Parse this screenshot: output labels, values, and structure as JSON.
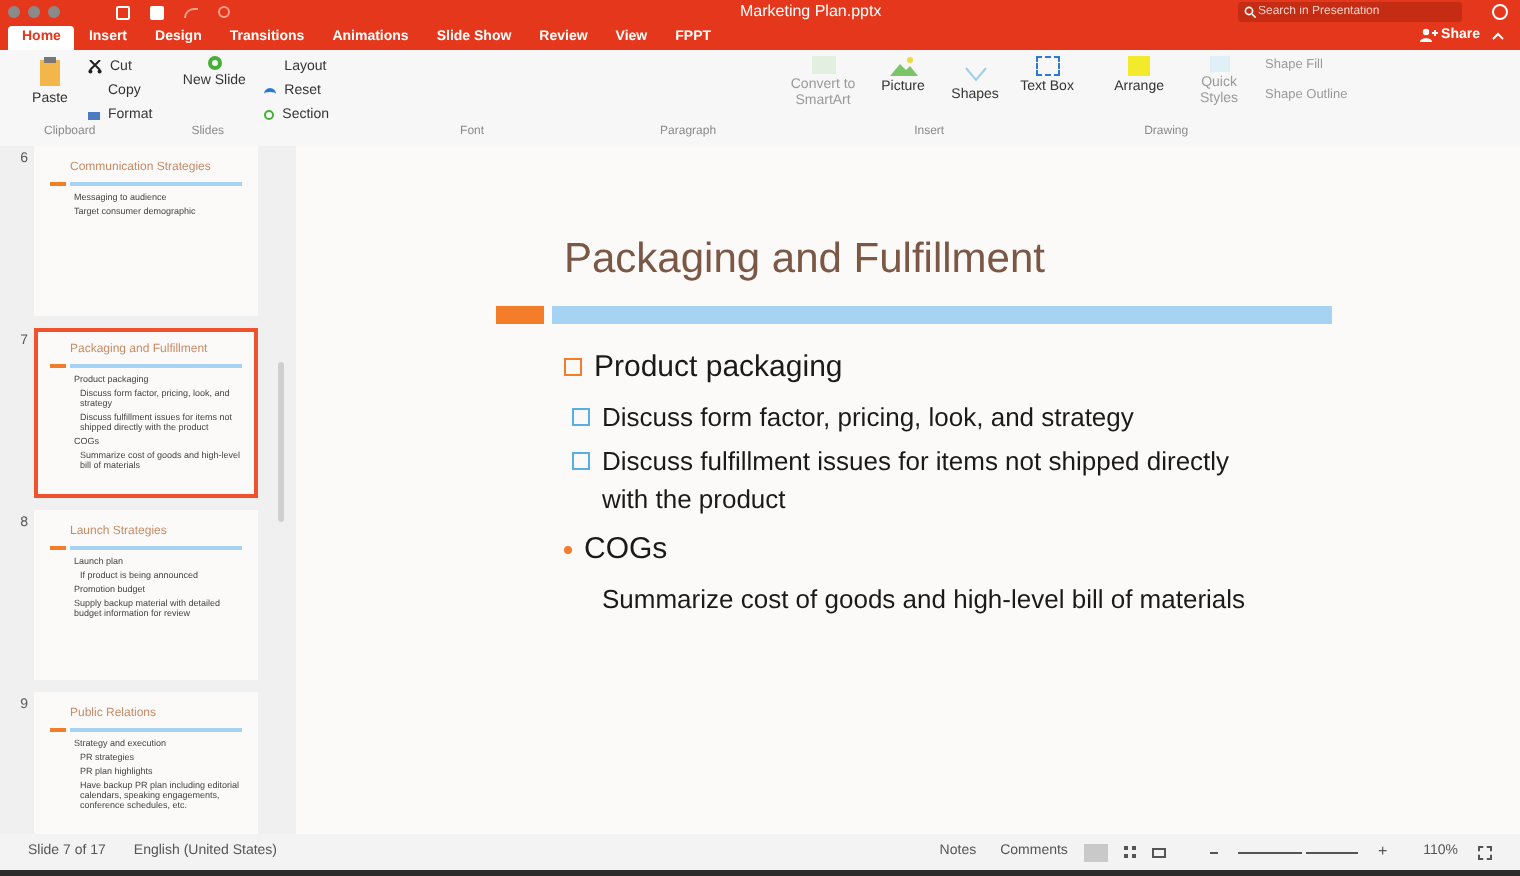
{
  "window": {
    "title": "Marketing Plan.pptx"
  },
  "search": {
    "placeholder": "Search in Presentation"
  },
  "tabs": [
    {
      "label": "Home",
      "selected": true
    },
    {
      "label": "Insert",
      "selected": false
    },
    {
      "label": "Design",
      "selected": false
    },
    {
      "label": "Transitions",
      "selected": false
    },
    {
      "label": "Animations",
      "selected": false
    },
    {
      "label": "Slide Show",
      "selected": false
    },
    {
      "label": "Review",
      "selected": false
    },
    {
      "label": "View",
      "selected": false
    },
    {
      "label": "FPPT",
      "selected": false
    }
  ],
  "share": "Share",
  "ribbon": {
    "paste": "Paste",
    "cut": "Cut",
    "copy": "Copy",
    "format": "Format",
    "new_slide": "New Slide",
    "layout": "Layout",
    "reset": "Reset",
    "section": "Section",
    "convert": {
      "label": "Convert to SmartArt",
      "disabled": true
    },
    "picture": "Picture",
    "shapes": "Shapes",
    "text_box": "Text Box",
    "arrange": "Arrange",
    "quick_styles": {
      "label": "Quick Styles",
      "disabled": true
    },
    "shape_fill": {
      "label": "Shape Fill",
      "disabled": true
    },
    "shape_outline": {
      "label": "Shape Outline",
      "disabled": true
    },
    "group_labels": [
      "Clipboard",
      "Slides",
      "Font",
      "Paragraph",
      "Insert",
      "Drawing"
    ]
  },
  "thumbnails": [
    {
      "number": "6",
      "title": "Communication Strategies",
      "selected": false,
      "lines": [
        {
          "text": "Messaging to audience"
        },
        {
          "text": "Target consumer demographic"
        }
      ]
    },
    {
      "number": "7",
      "title": "Packaging and Fulfillment",
      "selected": true,
      "lines": [
        {
          "text": "Product packaging",
          "children": [
            {
              "text": "Discuss form factor, pricing, look, and strategy"
            },
            {
              "text": "Discuss fulfillment issues for items not shipped directly with the product"
            }
          ]
        },
        {
          "text": "COGs",
          "children": [
            {
              "text": "Summarize cost of goods and high-level bill of materials"
            }
          ]
        }
      ]
    },
    {
      "number": "8",
      "title": "Launch Strategies",
      "selected": false,
      "lines": [
        {
          "text": "Launch plan",
          "children": [
            {
              "text": "If product is being announced"
            }
          ]
        },
        {
          "text": "Promotion budget"
        },
        {
          "text": "Supply backup material with detailed budget information for review"
        }
      ]
    },
    {
      "number": "9",
      "title": "Public Relations",
      "selected": false,
      "lines": [
        {
          "text": "Strategy and execution",
          "children": [
            {
              "text": "PR strategies"
            },
            {
              "text": "PR plan highlights"
            },
            {
              "text": "Have backup PR plan including editorial calendars, speaking engagements, conference schedules, etc."
            }
          ]
        }
      ]
    }
  ],
  "slide": {
    "title": "Packaging and Fulfillment",
    "bullets": [
      {
        "text": "Product packaging",
        "kind": "square",
        "children": [
          {
            "text": "Discuss form factor, pricing, look, and strategy",
            "kind": "square"
          },
          {
            "text": "Discuss fulfillment issues for items not shipped directly with the product",
            "kind": "square"
          }
        ]
      },
      {
        "text": "COGs",
        "kind": "dot",
        "children": [
          {
            "text": "Summarize cost of goods and high-level bill of materials",
            "kind": "none"
          }
        ]
      }
    ]
  },
  "status_bar": {
    "slide": "Slide 7 of 17",
    "language": "English (United States)",
    "notes": "Notes",
    "comments": "Comments",
    "zoom": "110%",
    "zoom_slider": {
      "level": 0.55
    },
    "zoom_in": "+"
  }
}
